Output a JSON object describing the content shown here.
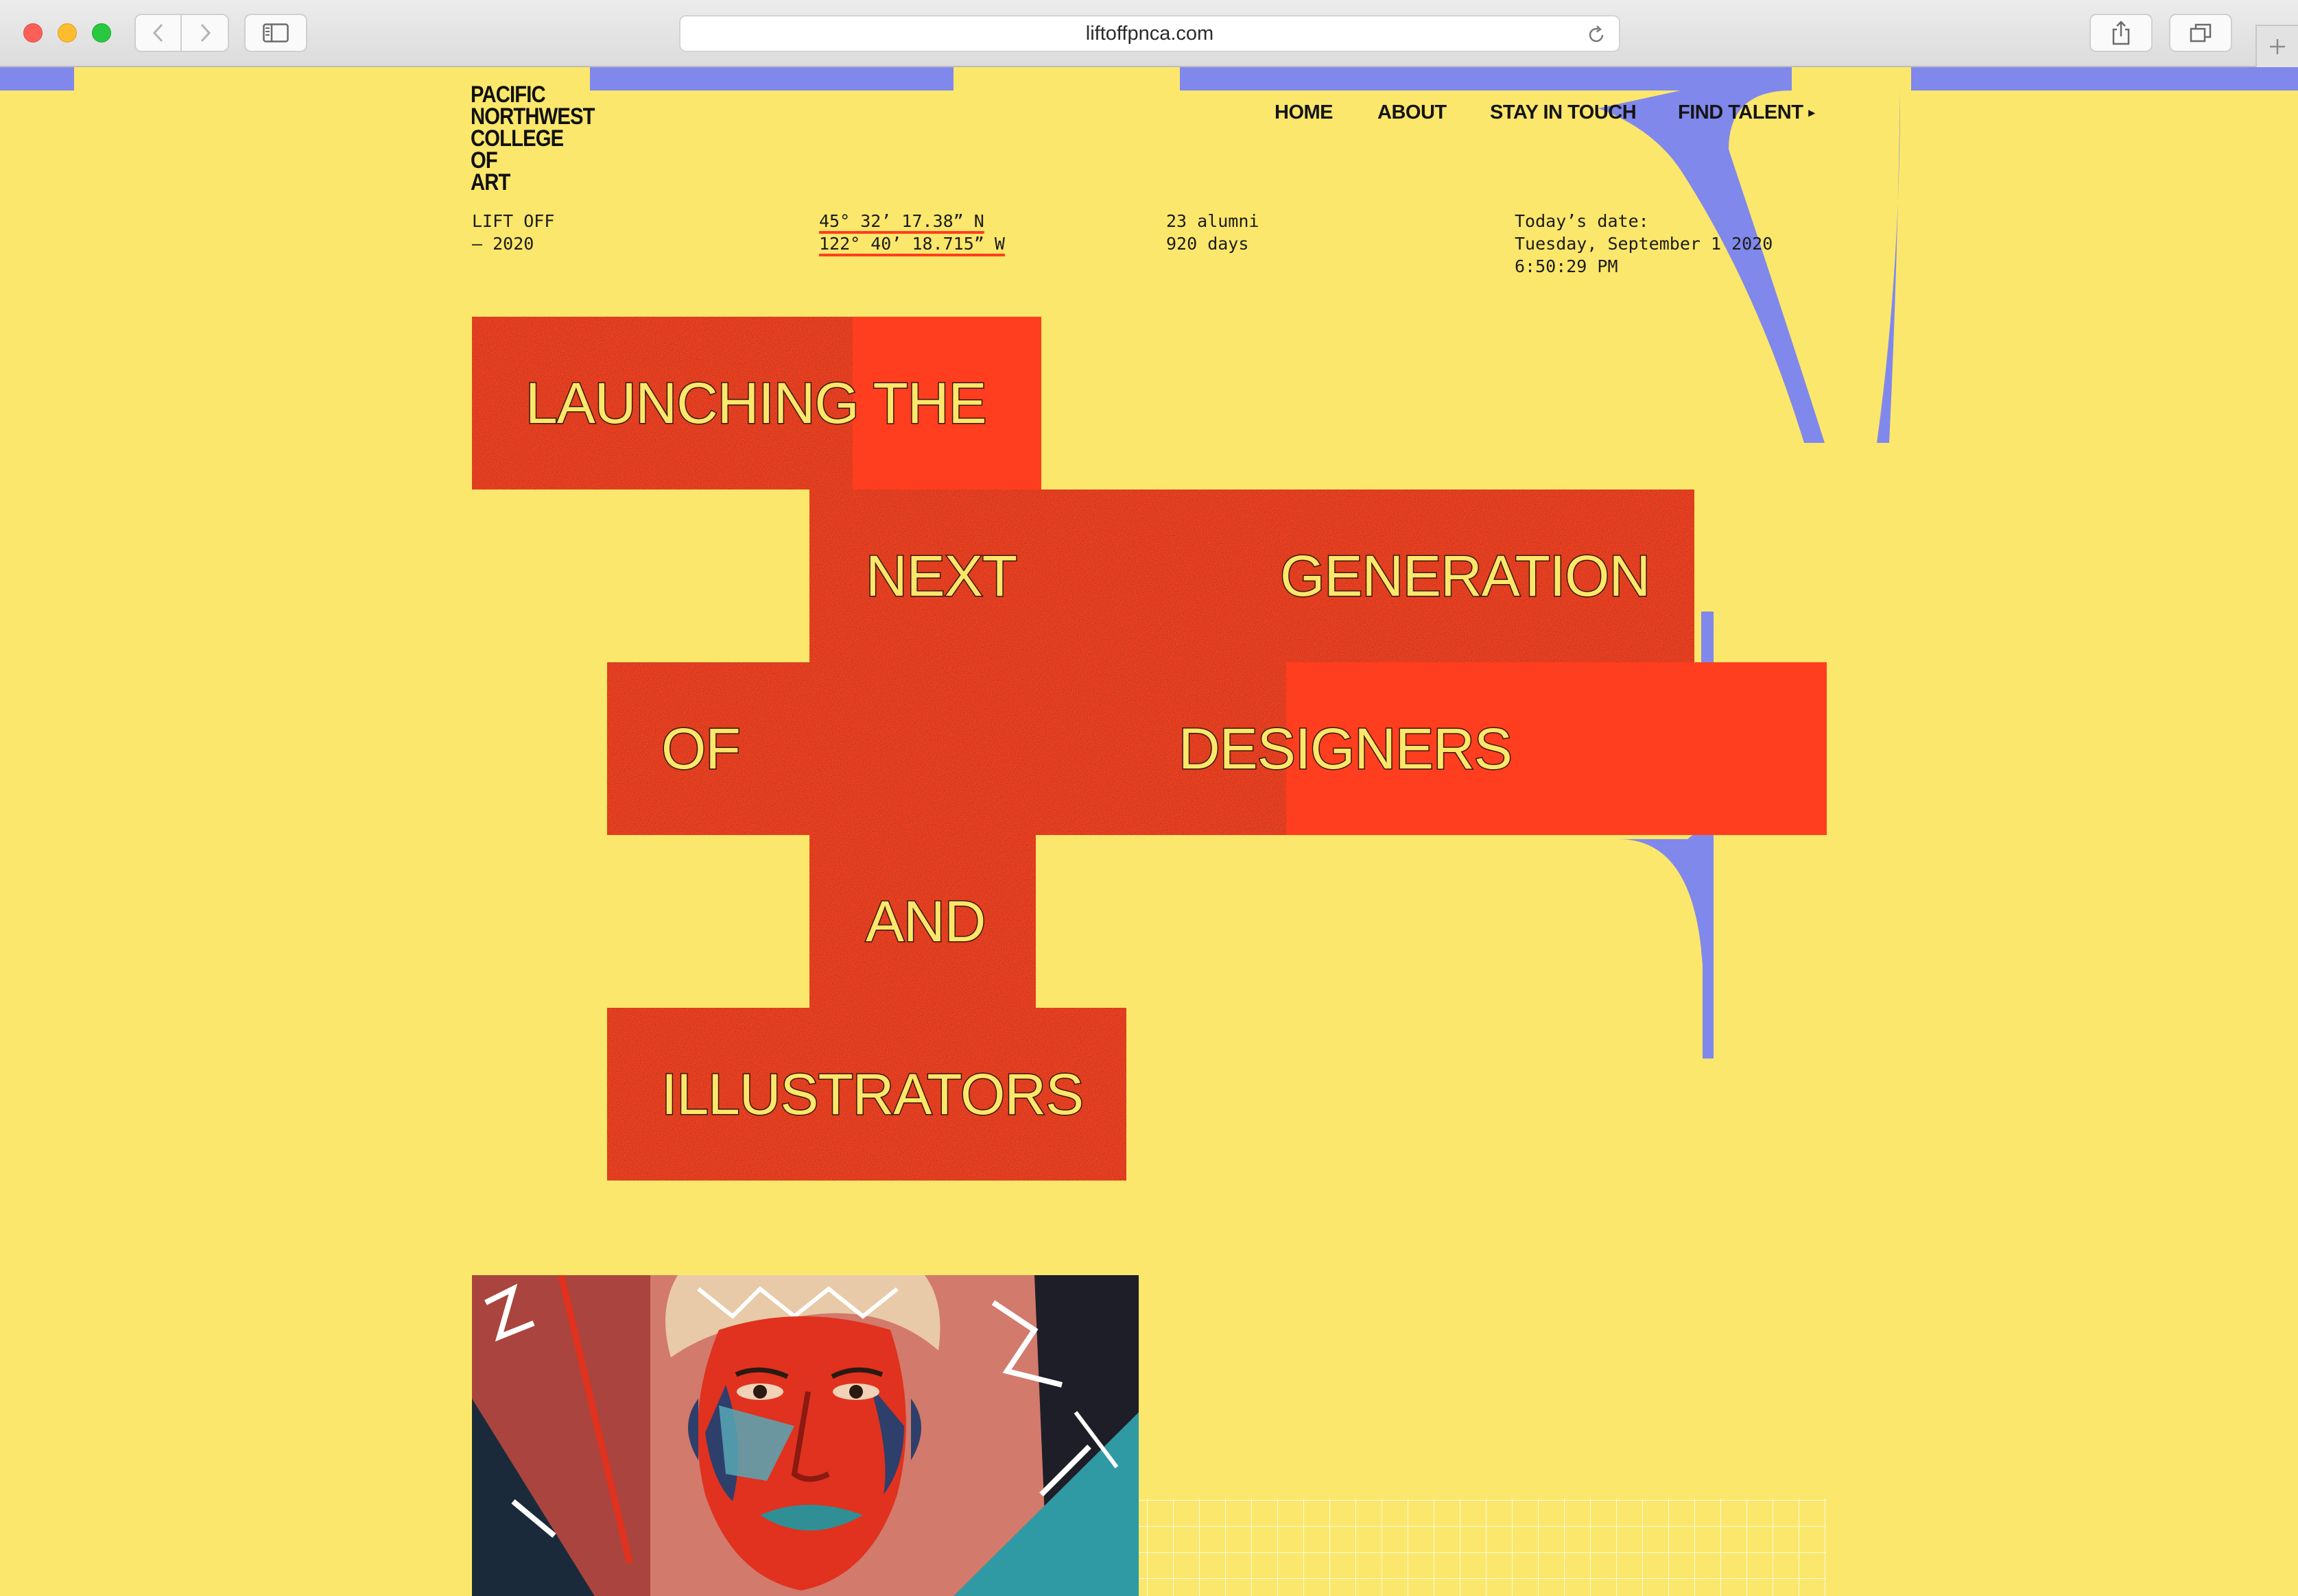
{
  "browser": {
    "url": "liftoffpnca.com",
    "icons": {
      "back": "chevron-left-icon",
      "forward": "chevron-right-icon",
      "sidebar": "sidebar-icon",
      "reload": "reload-icon",
      "share": "share-icon",
      "tabs": "tabs-overview-icon",
      "new_tab": "plus-icon"
    }
  },
  "site": {
    "logo_lines": [
      "PACIFIC",
      "NORTHWEST",
      "COLLEGE OF",
      "ART"
    ],
    "nav": [
      {
        "label": "HOME"
      },
      {
        "label": "ABOUT"
      },
      {
        "label": "STAY IN TOUCH"
      },
      {
        "label": "FIND TALENT"
      }
    ],
    "nav_caret": "▸",
    "meta": {
      "event": [
        "LIFT OFF",
        "— 2020"
      ],
      "coordinates": [
        "45° 32’ 17.38” N",
        "122° 40’ 18.715” W"
      ],
      "stats": [
        "23 alumni",
        "920 days"
      ],
      "date": [
        "Today’s date:",
        "Tuesday, September 1 2020",
        "6:50:29 PM"
      ]
    },
    "hero_words": [
      "LAUNCHING THE",
      "NEXT",
      "GENERATION",
      "OF",
      "DESIGNERS",
      "AND",
      "ILLUSTRATORS"
    ],
    "colors": {
      "background": "#fbe76b",
      "letterform": "#8088ec",
      "block": "#ff3e1f",
      "text": "#151515"
    }
  }
}
